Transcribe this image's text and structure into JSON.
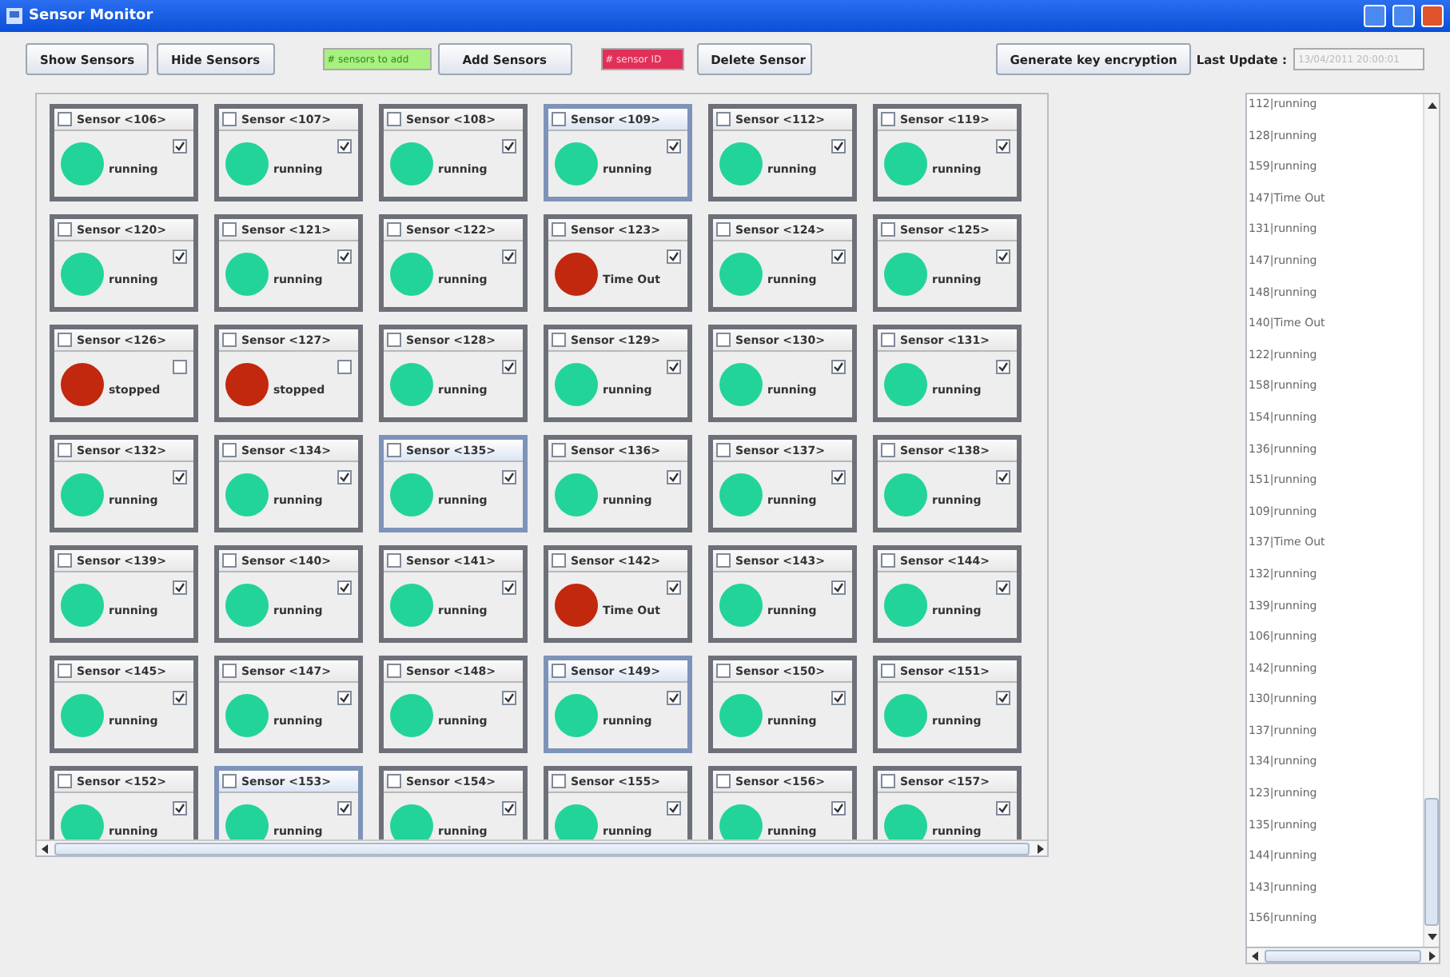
{
  "window": {
    "title": "Sensor Monitor"
  },
  "toolbar": {
    "show_button": "Show Sensors",
    "hide_button": "Hide Sensors",
    "count_field": {
      "placeholder": "# sensors to add"
    },
    "add_button": "Add Sensors",
    "id_field": {
      "placeholder": "# sensor ID"
    },
    "delete_button": "Delete Sensor",
    "encrypt_button": "Generate key encryption",
    "last_update_label": "Last Update :",
    "last_update_value": "13/04/2011 20:00:01"
  },
  "sensors": [
    {
      "name": "Sensor <106>",
      "status": "running",
      "color": "#22d49a",
      "checked": true,
      "selected": false
    },
    {
      "name": "Sensor <107>",
      "status": "running",
      "color": "#22d49a",
      "checked": true,
      "selected": false
    },
    {
      "name": "Sensor <108>",
      "status": "running",
      "color": "#22d49a",
      "checked": true,
      "selected": false
    },
    {
      "name": "Sensor <109>",
      "status": "running",
      "color": "#22d49a",
      "checked": true,
      "selected": true
    },
    {
      "name": "Sensor <112>",
      "status": "running",
      "color": "#22d49a",
      "checked": true,
      "selected": false
    },
    {
      "name": "Sensor <119>",
      "status": "running",
      "color": "#22d49a",
      "checked": true,
      "selected": false
    },
    {
      "name": "Sensor <120>",
      "status": "running",
      "color": "#22d49a",
      "checked": true,
      "selected": false
    },
    {
      "name": "Sensor <121>",
      "status": "running",
      "color": "#22d49a",
      "checked": true,
      "selected": false
    },
    {
      "name": "Sensor <122>",
      "status": "running",
      "color": "#22d49a",
      "checked": true,
      "selected": false
    },
    {
      "name": "Sensor <123>",
      "status": "Time Out",
      "color": "#c2280e",
      "checked": true,
      "selected": false
    },
    {
      "name": "Sensor <124>",
      "status": "running",
      "color": "#22d49a",
      "checked": true,
      "selected": false
    },
    {
      "name": "Sensor <125>",
      "status": "running",
      "color": "#22d49a",
      "checked": true,
      "selected": false
    },
    {
      "name": "Sensor <126>",
      "status": "stopped",
      "color": "#c2280e",
      "checked": false,
      "selected": false
    },
    {
      "name": "Sensor <127>",
      "status": "stopped",
      "color": "#c2280e",
      "checked": false,
      "selected": false
    },
    {
      "name": "Sensor <128>",
      "status": "running",
      "color": "#22d49a",
      "checked": true,
      "selected": false
    },
    {
      "name": "Sensor <129>",
      "status": "running",
      "color": "#22d49a",
      "checked": true,
      "selected": false
    },
    {
      "name": "Sensor <130>",
      "status": "running",
      "color": "#22d49a",
      "checked": true,
      "selected": false
    },
    {
      "name": "Sensor <131>",
      "status": "running",
      "color": "#22d49a",
      "checked": true,
      "selected": false
    },
    {
      "name": "Sensor <132>",
      "status": "running",
      "color": "#22d49a",
      "checked": true,
      "selected": false
    },
    {
      "name": "Sensor <134>",
      "status": "running",
      "color": "#22d49a",
      "checked": true,
      "selected": false
    },
    {
      "name": "Sensor <135>",
      "status": "running",
      "color": "#22d49a",
      "checked": true,
      "selected": true
    },
    {
      "name": "Sensor <136>",
      "status": "running",
      "color": "#22d49a",
      "checked": true,
      "selected": false
    },
    {
      "name": "Sensor <137>",
      "status": "running",
      "color": "#22d49a",
      "checked": true,
      "selected": false
    },
    {
      "name": "Sensor <138>",
      "status": "running",
      "color": "#22d49a",
      "checked": true,
      "selected": false
    },
    {
      "name": "Sensor <139>",
      "status": "running",
      "color": "#22d49a",
      "checked": true,
      "selected": false
    },
    {
      "name": "Sensor <140>",
      "status": "running",
      "color": "#22d49a",
      "checked": true,
      "selected": false
    },
    {
      "name": "Sensor <141>",
      "status": "running",
      "color": "#22d49a",
      "checked": true,
      "selected": false
    },
    {
      "name": "Sensor <142>",
      "status": "Time Out",
      "color": "#c2280e",
      "checked": true,
      "selected": false
    },
    {
      "name": "Sensor <143>",
      "status": "running",
      "color": "#22d49a",
      "checked": true,
      "selected": false
    },
    {
      "name": "Sensor <144>",
      "status": "running",
      "color": "#22d49a",
      "checked": true,
      "selected": false
    },
    {
      "name": "Sensor <145>",
      "status": "running",
      "color": "#22d49a",
      "checked": true,
      "selected": false
    },
    {
      "name": "Sensor <147>",
      "status": "running",
      "color": "#22d49a",
      "checked": true,
      "selected": false
    },
    {
      "name": "Sensor <148>",
      "status": "running",
      "color": "#22d49a",
      "checked": true,
      "selected": false
    },
    {
      "name": "Sensor <149>",
      "status": "running",
      "color": "#22d49a",
      "checked": true,
      "selected": true
    },
    {
      "name": "Sensor <150>",
      "status": "running",
      "color": "#22d49a",
      "checked": true,
      "selected": false
    },
    {
      "name": "Sensor <151>",
      "status": "running",
      "color": "#22d49a",
      "checked": true,
      "selected": false
    },
    {
      "name": "Sensor <152>",
      "status": "running",
      "color": "#22d49a",
      "checked": true,
      "selected": false
    },
    {
      "name": "Sensor <153>",
      "status": "running",
      "color": "#22d49a",
      "checked": true,
      "selected": true
    },
    {
      "name": "Sensor <154>",
      "status": "running",
      "color": "#22d49a",
      "checked": true,
      "selected": false
    },
    {
      "name": "Sensor <155>",
      "status": "running",
      "color": "#22d49a",
      "checked": true,
      "selected": false
    },
    {
      "name": "Sensor <156>",
      "status": "running",
      "color": "#22d49a",
      "checked": true,
      "selected": false
    },
    {
      "name": "Sensor <157>",
      "status": "running",
      "color": "#22d49a",
      "checked": true,
      "selected": false
    }
  ],
  "log": [
    "112|running",
    "128|running",
    "159|running",
    "147|Time Out",
    "131|running",
    "147|running",
    "148|running",
    "140|Time Out",
    "122|running",
    "158|running",
    "154|running",
    "136|running",
    "151|running",
    "109|running",
    "137|Time Out",
    "132|running",
    "139|running",
    "106|running",
    "142|running",
    "130|running",
    "137|running",
    "134|running",
    "123|running",
    "135|running",
    "144|running",
    "143|running",
    "156|running"
  ]
}
